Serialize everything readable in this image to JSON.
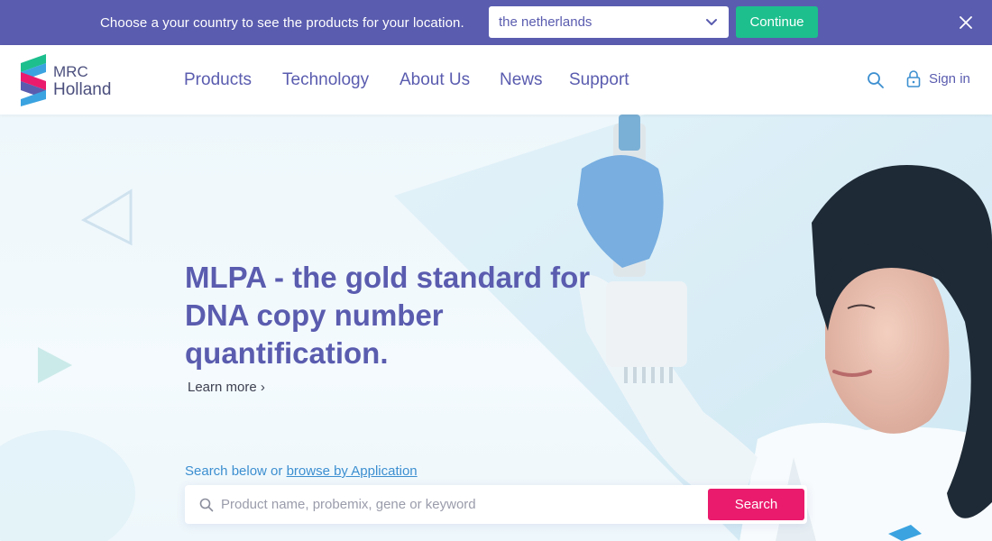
{
  "country_banner": {
    "message": "Choose a your country to see the products for your location.",
    "selected_country": "the netherlands",
    "continue_label": "Continue"
  },
  "header": {
    "logo_line1": "MRC",
    "logo_line2": "Holland",
    "nav": [
      "Products",
      "Technology",
      "About Us",
      "News",
      "Support"
    ],
    "signin_label": "Sign in"
  },
  "hero": {
    "title": "MLPA - the gold standard for DNA copy number quantification.",
    "learn_more": "Learn more ›",
    "search_hint_prefix": "Search below or ",
    "search_hint_link": "browse by Application",
    "search_placeholder": "Product name, probemix, gene or keyword",
    "search_button": "Search"
  },
  "colors": {
    "brand_purple": "#5a5caf",
    "continue_green": "#1dbf8d",
    "search_pink": "#ea1b6c",
    "link_blue": "#3c8fd0"
  },
  "icons": [
    "chevron-down-icon",
    "close-icon",
    "search-icon",
    "lock-icon",
    "logo-mark"
  ]
}
